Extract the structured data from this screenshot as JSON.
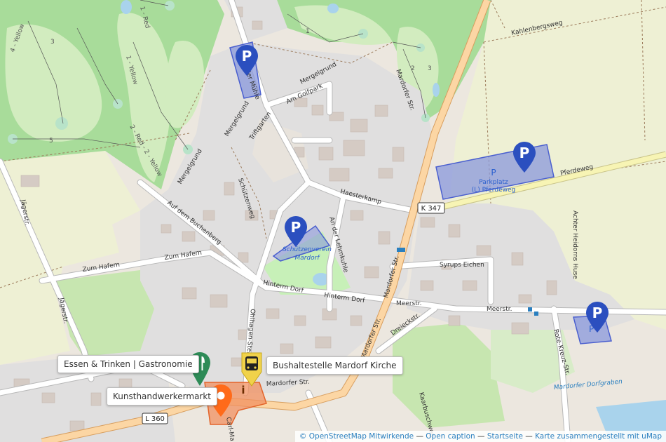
{
  "colors": {
    "golf": "#a8dc9a",
    "golf_fairway": "#d2ecbf",
    "farmland": "#eef0d4",
    "residential": "#e0dfdf",
    "building": "#d9d0c9",
    "road": "#ffffff",
    "primary_road": "#f8c88e",
    "parking_fill": "#8a98dc",
    "parking_stroke": "#4a5fcf",
    "pin_blue": "#2b4fbf",
    "pin_green": "#2e8b57",
    "pin_yellow": "#f0d24a",
    "pin_orange": "#ff6a1a"
  },
  "streets": {
    "kahlenbergsweg": "Kahlenbergsweg",
    "mergelgrund_top": "Mergelgrund",
    "mergelgrund_left": "Mergelgrund",
    "mergelgrund_bottom": "Mergelgrund",
    "am_golfpark": "Am Golfpark",
    "triftgarten": "Triftgarten",
    "mardorfer_str_top": "Mardorfer Str.",
    "mardorfer_str_mid": "Mardorfer Str.",
    "mardorfer_str_low": "Mardorfer Str.",
    "mardorfer_str_bottom": "Mardorfer Str.",
    "haesterkamp": "Haesterkamp",
    "pferdeweg": "Pferdeweg",
    "k347": "K 347",
    "schuetzenweg": "Schützenweg",
    "auf_dem_buchenberg": "Auf dem Buchenberg",
    "an_der_lehmkuhle": "An der Lehmkuhle",
    "zum_hafern_left": "Zum Hafern",
    "zum_hafern_right": "Zum Hafern",
    "hinterm_dorf_1": "Hinterm Dorf",
    "hinterm_dorf_2": "Hinterm Dorf",
    "syrups_eichen": "Syrups Eichen",
    "meerstr_1": "Meerstr.",
    "meerstr_2": "Meerstr.",
    "dreieckstr": "Dreieckstr.",
    "achter_heidorns_huse": "Achter Heidorns Huse",
    "jaegerstr_top": "Jägerstr.",
    "jaegerstr_bottom": "Jägerstr.",
    "ohlhagen_steinweg": "Ohlhagen-Steinweg",
    "rote_kreuz_str": "Rote-Kreuz-Str.",
    "kaarbuschweg": "Kaarbuschweg",
    "l360": "L 360",
    "carl": "Carl-Ma",
    "muehle": "der Mühle",
    "mardorfer_dorfgraben": "Mardorfer Dorfgraben"
  },
  "golf_labels": {
    "yellow_4": "4 - Yellow",
    "yellow_1": "1 - Yellow",
    "red_1": "1 - Red",
    "red_2": "2 - Red - 2 - Yellow",
    "n3": "3",
    "n5": "5",
    "n1": "1",
    "n2": "2",
    "n3b": "3"
  },
  "areas": {
    "parkplatz_title": "P",
    "parkplatz_name": "Parkplatz",
    "parkplatz_sub": "(L) Pferdeweg",
    "schuetzenverein_1": "Schützenverein",
    "schuetzenverein_2": "Mardorf",
    "p_small": "P"
  },
  "pins": {
    "parking_glyph": "P",
    "info_glyph": "i"
  },
  "poi_labels": {
    "essen": "Essen & Trinken | Gastronomie",
    "bus": "Bushaltestelle Mardorf Kirche",
    "kunst": "Kunsthandwerkermarkt"
  },
  "attribution": {
    "osm": "© OpenStreetMap",
    "mitwirkende": "Mitwirkende",
    "dash1": "—",
    "open_caption": "Open caption",
    "dash2": "—",
    "startseite": "Startseite",
    "dash3": "—",
    "karte": "Karte zusammengestellt mit uMap"
  }
}
